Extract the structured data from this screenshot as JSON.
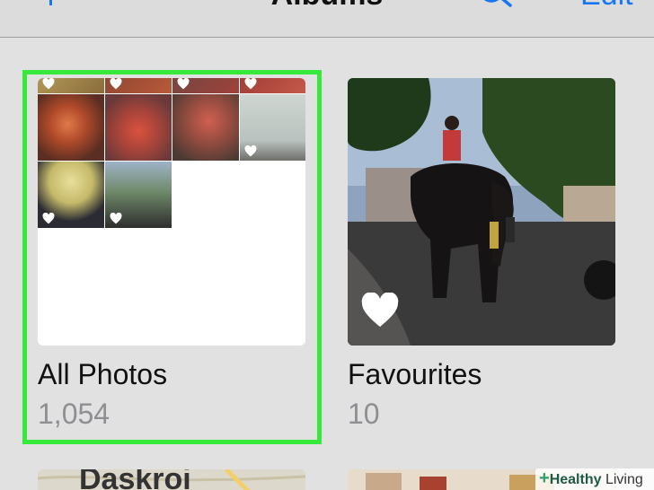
{
  "nav": {
    "title": "Albums",
    "edit_label": "Edit"
  },
  "albums": [
    {
      "title": "All Photos",
      "count": "1,054",
      "selected": true
    },
    {
      "title": "Favourites",
      "count": "10",
      "selected": false
    }
  ],
  "next_row": {
    "map_label": "Daskroi"
  },
  "watermark": {
    "text_a": "Healthy",
    "text_b": "Living"
  },
  "colors": {
    "accent": "#1676f3",
    "highlight": "#36e93a",
    "background": "#e1e1e1"
  }
}
